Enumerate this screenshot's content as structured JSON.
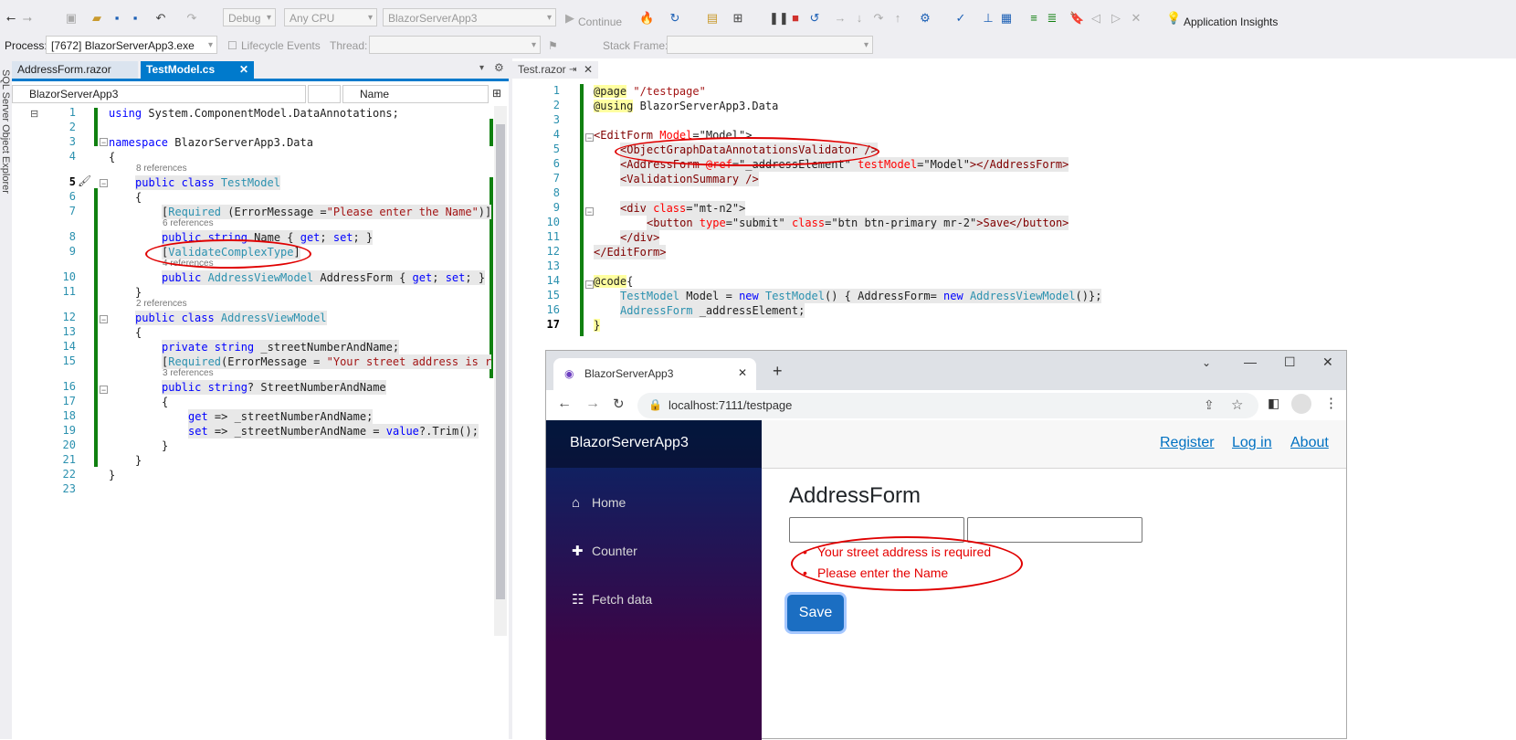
{
  "toolbar": {
    "config": "Debug",
    "platform": "Any CPU",
    "startup_project": "BlazorServerApp3",
    "continue": "Continue",
    "app_insights": "Application Insights"
  },
  "debugbar": {
    "process_label": "Process:",
    "process_value": "[7672] BlazorServerApp3.exe",
    "lifecycle": "Lifecycle Events",
    "thread_label": "Thread:",
    "stack_label": "Stack Frame:"
  },
  "side_label": "SQL Server Object Explorer",
  "left_tabs": {
    "tab1": "AddressForm.razor",
    "tab2": "TestModel.cs"
  },
  "left_nav": {
    "project": "BlazorServerApp3",
    "member": "Name"
  },
  "left_code": {
    "line_numbers": [
      "1",
      "2",
      "3",
      "4",
      "5",
      "6",
      "7",
      "8",
      "9",
      "10",
      "11",
      "12",
      "13",
      "14",
      "15",
      "16",
      "17",
      "18",
      "19",
      "20",
      "21",
      "22",
      "23"
    ],
    "refs": {
      "r1": "8 references",
      "r2": "6 references",
      "r3": "4 references",
      "r4": "2 references",
      "r5": "3 references"
    },
    "l1_using": "using",
    "l1_ns": " System.ComponentModel.DataAnnotations;",
    "l3_ns": "namespace",
    "l3_name": " BlazorServerApp3.Data",
    "l4": "{",
    "l5_a": "public class ",
    "l5_b": "TestModel",
    "l6": "{",
    "l7_a": "[",
    "l7_b": "Required",
    "l7_c": " (ErrorMessage =",
    "l7_d": "\"Please enter the Name\"",
    "l7_e": ")]",
    "l8_a": "public string",
    "l8_b": " Name { ",
    "l8_c": "get",
    "l8_d": "; ",
    "l8_e": "set",
    "l8_f": "; }",
    "l9_a": "[",
    "l9_b": "ValidateComplexType",
    "l9_c": "]",
    "l10_a": "public ",
    "l10_b": "AddressViewModel",
    "l10_c": " AddressForm { ",
    "l10_d": "get",
    "l10_e": "; ",
    "l10_f": "set",
    "l10_g": "; }",
    "l11": "}",
    "l12_a": "public class ",
    "l12_b": "AddressViewModel",
    "l13": "{",
    "l14_a": "private string",
    "l14_b": " _streetNumberAndName;",
    "l15_a": "[",
    "l15_b": "Required",
    "l15_c": "(ErrorMessage = ",
    "l15_d": "\"Your street address is r",
    "l16_a": "public string",
    "l16_b": "? StreetNumberAndName",
    "l17": "{",
    "l18_a": "get",
    "l18_b": " => _streetNumberAndName;",
    "l19_a": "set",
    "l19_b": " => _streetNumberAndName = ",
    "l19_c": "value",
    "l19_d": "?.Trim();",
    "l20": "}",
    "l21": "}",
    "l22": "}"
  },
  "right_tab": "Test.razor",
  "right_code": {
    "line_numbers": [
      "1",
      "2",
      "3",
      "4",
      "5",
      "6",
      "7",
      "8",
      "9",
      "10",
      "11",
      "12",
      "13",
      "14",
      "15",
      "16",
      "17"
    ],
    "l1_a": "@page",
    "l1_b": " \"/testpage\"",
    "l2_a": "@using",
    "l2_b": " BlazorServerApp3.Data",
    "l4_a": "<EditForm",
    "l4_b": " Model",
    "l4_c": "=\"Model\">",
    "l5": "<ObjectGraphDataAnnotationsValidator />",
    "l6_a": "<AddressForm",
    "l6_b": " @ref",
    "l6_c": "=\"_addressElement\"",
    "l6_d": " testModel",
    "l6_e": "=\"Model\"",
    "l6_f": "></AddressForm>",
    "l7": "<ValidationSummary />",
    "l9_a": "<div",
    "l9_b": " class",
    "l9_c": "=\"mt-n2\">",
    "l10_a": "<button",
    "l10_b": " type",
    "l10_c": "=\"submit\"",
    "l10_d": " class",
    "l10_e": "=\"btn btn-primary mr-2\"",
    "l10_f": ">Save</button>",
    "l11": "</div>",
    "l12": "</EditForm>",
    "l14_a": "@code",
    "l14_b": "{",
    "l15_a": "TestModel",
    "l15_b": " Model = ",
    "l15_c": "new ",
    "l15_d": "TestModel",
    "l15_e": "() { AddressForm= ",
    "l15_f": "new ",
    "l15_g": "AddressViewModel",
    "l15_h": "()};",
    "l16_a": "AddressForm",
    "l16_b": " _addressElement;",
    "l17": "}"
  },
  "browser": {
    "tab_title": "BlazorServerApp3",
    "url": "localhost:7111/testpage",
    "brand": "BlazorServerApp3",
    "nav": [
      "Home",
      "Counter",
      "Fetch data"
    ],
    "top_links": [
      "Register",
      "Log in",
      "About"
    ],
    "heading": "AddressForm",
    "errors": [
      "Your street address is required",
      "Please enter the Name"
    ],
    "save": "Save"
  }
}
